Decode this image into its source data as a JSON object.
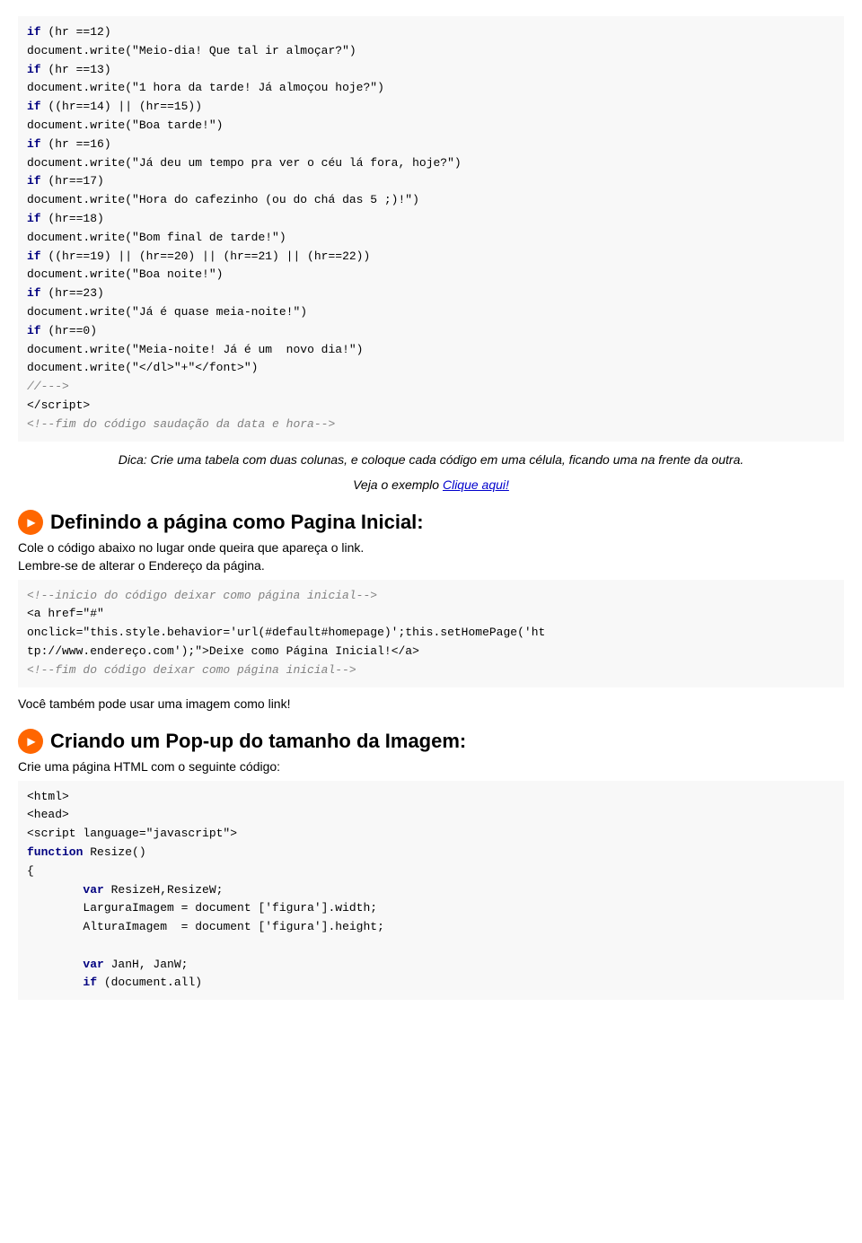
{
  "code_section1": {
    "lines": [
      {
        "type": "kw",
        "text": "if"
      },
      {
        "type": "normal",
        "text": " (hr ==12)"
      },
      {
        "type": "fn_write",
        "text": "document.write(\"Meio-dia! Que tal ir almo&ccedil;ar?\")"
      },
      {
        "type": "kw2",
        "text": "if"
      },
      {
        "type": "normal2",
        "text": " (hr ==13)"
      },
      {
        "type": "fn_write2",
        "text": "document.write(\"1 hora da tarde! J&aacute; almo&ccedil;ou hoje?\")"
      },
      {
        "type": "kw3",
        "text": "if"
      },
      {
        "type": "normal3",
        "text": " ((hr==14) || (hr==15))"
      },
      {
        "type": "fn_write3",
        "text": "document.write(\"Boa tarde!\")"
      },
      {
        "type": "kw4",
        "text": "if"
      },
      {
        "type": "normal4",
        "text": " (hr ==16)"
      }
    ]
  },
  "section_pagina_inicial": {
    "title": "Definindo a página como Pagina Inicial:",
    "desc1": "Cole o código abaixo no lugar onde queira que apareça o link.",
    "desc2": "Lembre-se de alterar o Endereço da página."
  },
  "section_popup": {
    "title": "Criando um Pop-up do tamanho da Imagem:",
    "desc1": "Crie uma página HTML com o seguinte código:"
  },
  "tip": {
    "text": "Dica: Crie uma tabela com duas colunas, e coloque cada código em uma célula, ficando uma na frente da outra.",
    "link_prefix": "Veja o exemplo ",
    "link_text": "Clique aqui!"
  },
  "plain_text": "Você também pode usar uma imagem como link!"
}
